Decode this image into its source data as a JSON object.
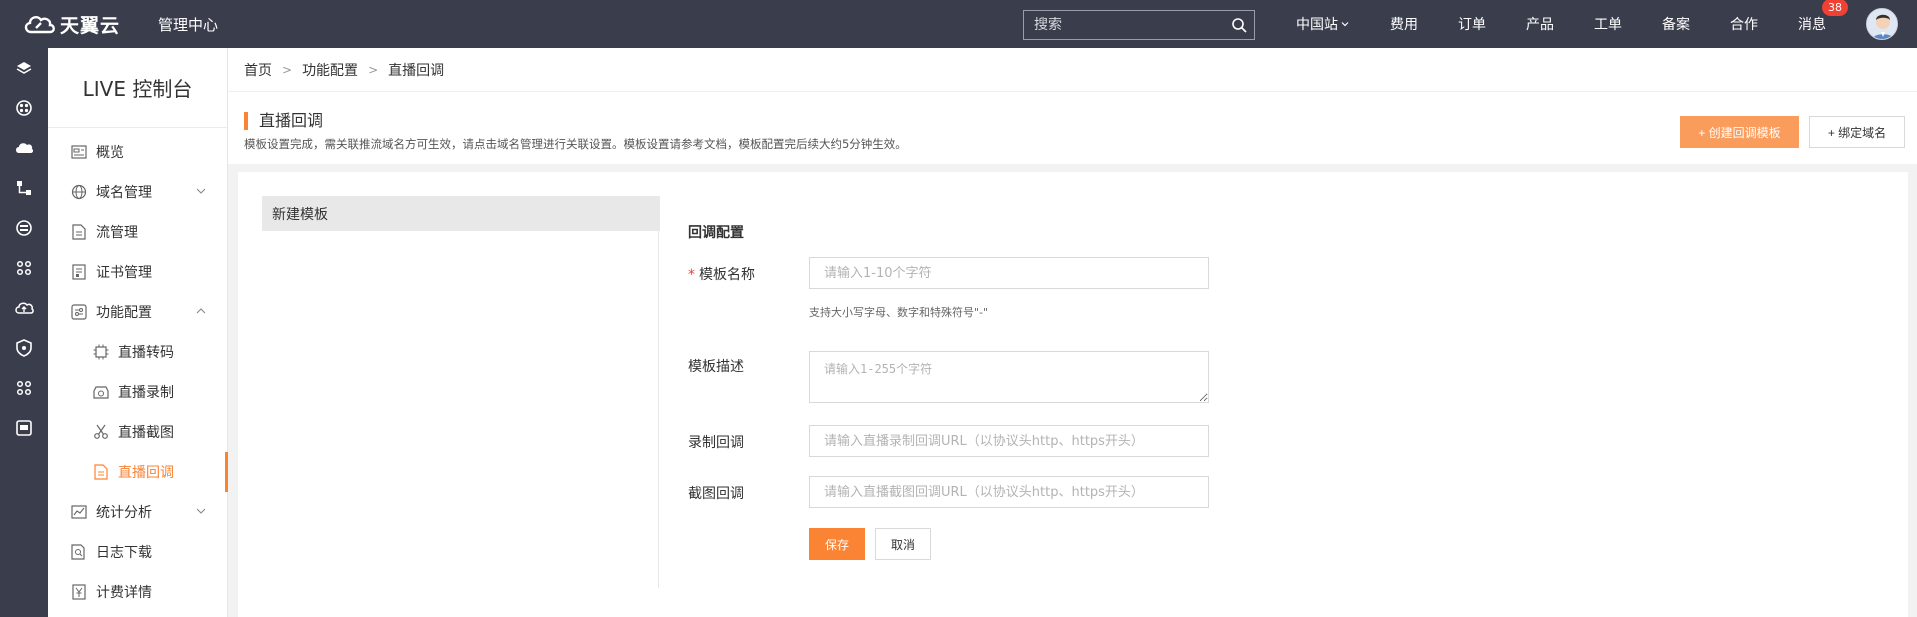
{
  "topbar": {
    "brand": "天翼云",
    "section": "管理中心",
    "search_placeholder": "搜索",
    "nav": [
      "中国站",
      "费用",
      "订单",
      "产品",
      "工单",
      "备案",
      "合作",
      "消息"
    ],
    "messages_badge": "38"
  },
  "rail_icons": [
    "layers-icon",
    "grid-circle-icon",
    "cloud-icon",
    "network-icon",
    "database-icon",
    "cross-icon",
    "cloud-upload-icon",
    "shield-icon",
    "cross-icon-2",
    "monitor-icon"
  ],
  "sidebar": {
    "title": "LIVE 控制台",
    "items": [
      {
        "label": "概览"
      },
      {
        "label": "域名管理"
      },
      {
        "label": "流管理"
      },
      {
        "label": "证书管理"
      },
      {
        "label": "功能配置"
      },
      {
        "label": "直播转码"
      },
      {
        "label": "直播录制"
      },
      {
        "label": "直播截图"
      },
      {
        "label": "直播回调"
      },
      {
        "label": "统计分析"
      },
      {
        "label": "日志下载"
      },
      {
        "label": "计费详情"
      }
    ]
  },
  "breadcrumb": [
    "首页",
    "功能配置",
    "直播回调"
  ],
  "page": {
    "title": "直播回调",
    "description": "模板设置完成，需关联推流域名方可生效，请点击域名管理进行关联设置。模板设置请参考文档，模板配置完后续大约5分钟生效。",
    "create_button": "+ 创建回调模板",
    "bind_button": "+ 绑定域名"
  },
  "template_list": [
    "新建模板"
  ],
  "form": {
    "title": "回调配置",
    "name_label": "模板名称",
    "name_placeholder": "请输入1-10个字符",
    "name_hint": "支持大小写字母、数字和特殊符号\"-\"",
    "desc_label": "模板描述",
    "desc_placeholder": "请输入1-255个字符",
    "record_label": "录制回调",
    "record_placeholder": "请输入直播录制回调URL（以协议头http、https开头）",
    "snapshot_label": "截图回调",
    "snapshot_placeholder": "请输入直播截图回调URL（以协议头http、https开头）",
    "save_button": "保存",
    "cancel_button": "取消"
  },
  "colors": {
    "topbar_bg": "#3a3d4c",
    "accent": "#fa8334",
    "accent_light": "#fa9d5c"
  }
}
